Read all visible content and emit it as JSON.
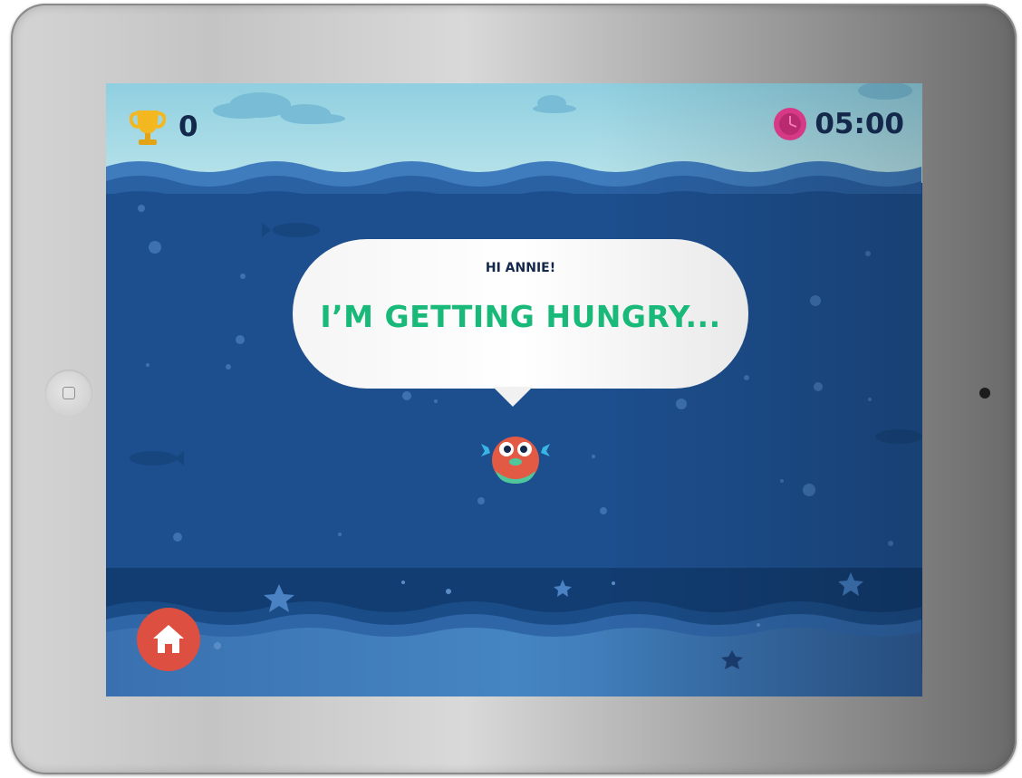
{
  "hud": {
    "score": "0",
    "score_icon": "trophy-icon",
    "timer": "05:00",
    "timer_icon": "clock-icon"
  },
  "bubble": {
    "greeting": "HI ANNIE!",
    "message": "I’M GETTING HUNGRY..."
  },
  "character": {
    "name": "pufferfish"
  },
  "controls": {
    "home_icon": "home-icon"
  },
  "colors": {
    "sky": "#9bd3e2",
    "water": "#1d4f8e",
    "accent_green": "#19b97a",
    "home_button": "#dd4f41",
    "trophy": "#f3b820",
    "clock": "#d63a86",
    "text_dark": "#13284a"
  }
}
